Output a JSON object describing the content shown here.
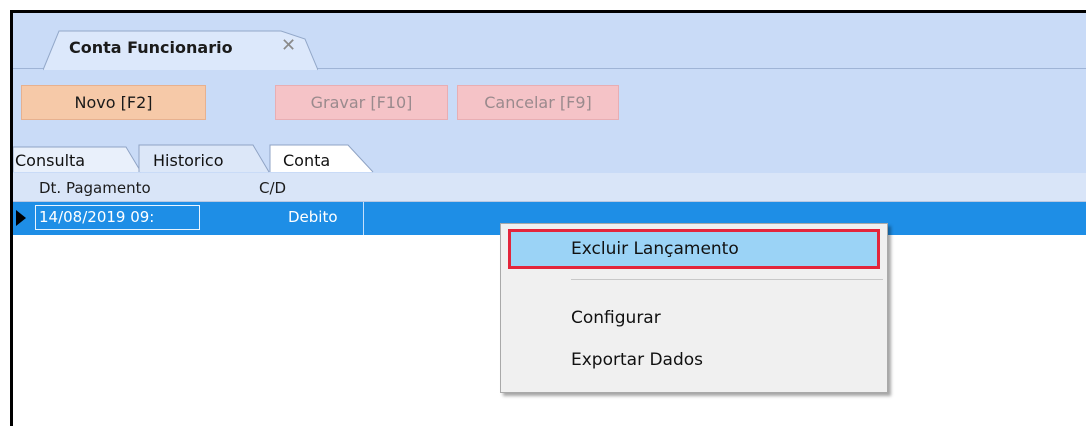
{
  "window": {
    "document_tab": {
      "title": "Conta Funcionario",
      "close_glyph": "✕"
    }
  },
  "toolbar": {
    "novo_label": "Novo [F2]",
    "gravar_label": "Gravar [F10]",
    "cancelar_label": "Cancelar [F9]"
  },
  "subtabs": [
    {
      "label": "Consulta"
    },
    {
      "label": "Historico"
    },
    {
      "label": "Conta"
    }
  ],
  "grid": {
    "columns": [
      "Dt. Pagamento",
      "C/D"
    ],
    "rows": [
      {
        "date": "14/08/2019 09:",
        "cd": "Debito",
        "selected": true
      }
    ]
  },
  "context_menu": {
    "items": [
      {
        "label": "Excluir Lançamento",
        "highlighted": true
      },
      {
        "label": "Configurar"
      },
      {
        "label": "Exportar Dados"
      }
    ]
  },
  "colors": {
    "band": "#c9dbf7",
    "selection": "#1e8ee6",
    "highlight_border": "#e3253b",
    "menu_highlight": "#9bd3f6"
  }
}
